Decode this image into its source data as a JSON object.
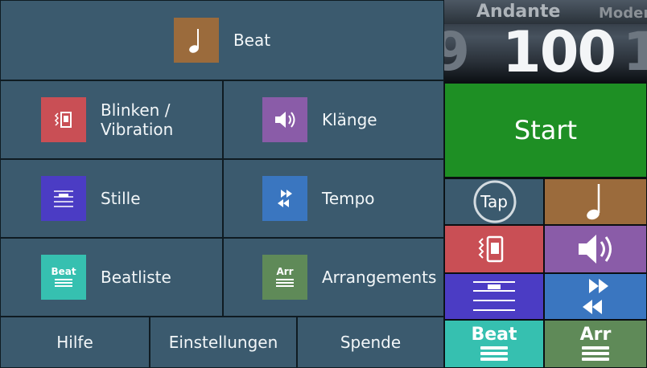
{
  "colors": {
    "panel": "#3b5a6e",
    "beat": "#9b6b3c",
    "flash": "#c94f55",
    "sound": "#8a5ca8",
    "silence": "#4b3cc4",
    "tempo": "#3a76c0",
    "beatlist": "#36c0b0",
    "arrangements": "#5f8a58",
    "start": "#1e8f24"
  },
  "menu": {
    "beat": {
      "label": "Beat",
      "icon": "quarter-note-icon"
    },
    "flash": {
      "label_line1": "Blinken /",
      "label_line2": "Vibration",
      "icon": "vibration-icon"
    },
    "sounds": {
      "label": "Klänge",
      "icon": "speaker-icon"
    },
    "silence": {
      "label": "Stille",
      "icon": "silence-lines-icon"
    },
    "tempo": {
      "label": "Tempo",
      "icon": "fast-forward-rewind-icon"
    },
    "beatlist": {
      "label": "Beatliste",
      "icon": "beat-list-icon",
      "icon_text": "Beat"
    },
    "arrangements": {
      "label": "Arrangements",
      "icon": "arrangement-icon",
      "icon_text": "Arr"
    }
  },
  "footer": {
    "help": "Hilfe",
    "settings": "Einstellungen",
    "donate": "Spende"
  },
  "tempo_display": {
    "marking": "Andante",
    "next_marking": "Moder",
    "bpm": "100",
    "prev_digit": "9",
    "next_digit": "1"
  },
  "controls": {
    "start": "Start",
    "tap": "Tap",
    "beat_icon_text": "Beat",
    "arr_icon_text": "Arr"
  }
}
